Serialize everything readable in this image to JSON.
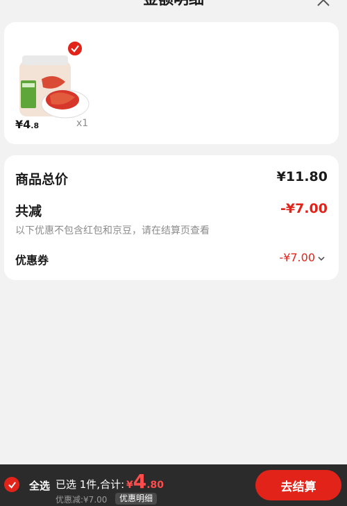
{
  "header": {
    "title": "金额明细"
  },
  "product": {
    "price_symbol": "¥",
    "price_integer": "4",
    "price_decimal": ".8",
    "quantity": "x1",
    "selected": true
  },
  "summary": {
    "total_label": "商品总价",
    "total_value": "¥11.80",
    "reduction_label": "共减",
    "reduction_value": "-¥7.00",
    "note": "以下优惠不包含红包和京豆，请在结算页查看",
    "coupon_label": "优惠券",
    "coupon_value": "-¥7.00"
  },
  "bottom_bar": {
    "select_all_label": "全选",
    "selected_text": "已选 1件,合计:",
    "total_currency": "¥",
    "total_integer": "4",
    "total_decimal": ".80",
    "discount_text": "优惠减:¥7.00",
    "detail_chip": "优惠明细",
    "checkout_label": "去结算"
  },
  "colors": {
    "accent": "#e2231a",
    "bar_bg": "#2b2b2b",
    "page_bg": "#f2f2f2"
  }
}
